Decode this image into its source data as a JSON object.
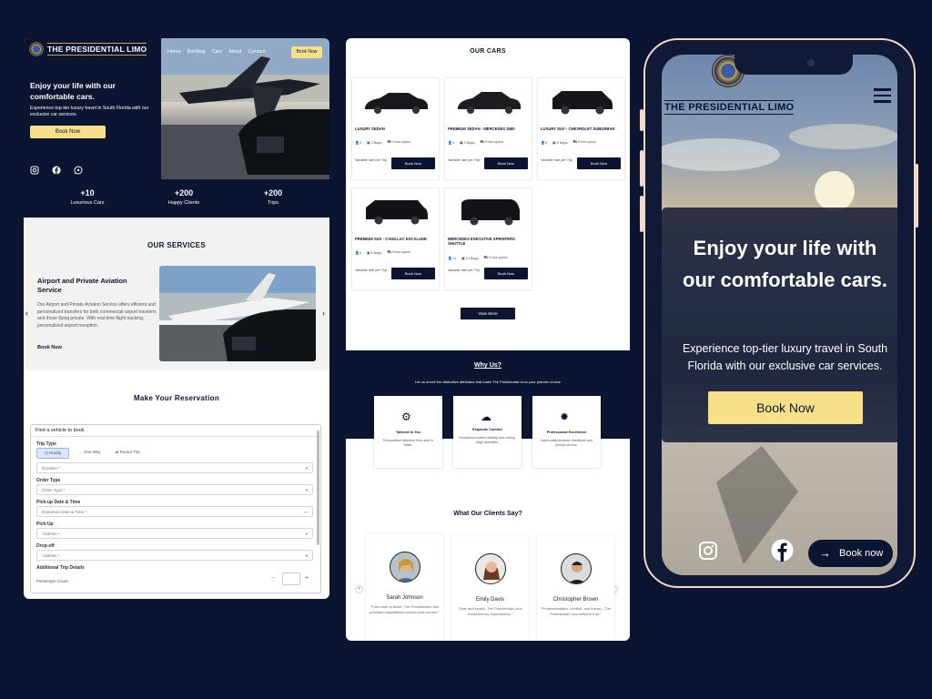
{
  "panel1": {
    "brand": "THE PRESIDENTIAL LIMO",
    "nav": [
      "Home",
      "Booking",
      "Cars",
      "About",
      "Contact"
    ],
    "nav_cta": "Book Now",
    "hero_title": "Enjoy your life with our comfortable cars.",
    "hero_sub": "Experience top-tier luxury travel in South Florida with our exclusive car services.",
    "hero_cta": "Book Now",
    "stats": [
      {
        "num": "+10",
        "label": "Luxurious Cars"
      },
      {
        "num": "+200",
        "label": "Happy Clients"
      },
      {
        "num": "+200",
        "label": "Trips"
      }
    ],
    "services_title": "OUR SERVICES",
    "service_name": "Airport and Private Aviation Service",
    "service_desc": "Our Airport and Private Aviation Service offers efficient and personalized transfers for both commercial airport travelers and those flying private. With real-time flight tracking, personalized airport reception.",
    "service_link": "Book Now",
    "reservation_title": "Make Your Reservation",
    "form": {
      "heading": "Find a vehicle to book",
      "trip_type_label": "Trip Type",
      "trip_types": [
        "Hourly",
        "One Way",
        "Round Trip"
      ],
      "duration_placeholder": "Duration *",
      "order_type_label": "Order Type",
      "order_type_placeholder": "Order Type *",
      "pickup_dt_label": "Pick-up Date & Time",
      "pickup_dt_placeholder": "Departure Date & Time *",
      "pickup_label": "Pick-Up",
      "pickup_placeholder": "Address *",
      "dropoff_label": "Drop-off",
      "dropoff_placeholder": "Address *",
      "additional_label": "Additional Trip Details",
      "passenger_label": "Passenger Count"
    }
  },
  "panel2": {
    "cars_title": "OUR CARS",
    "cars": [
      {
        "name": "LUXURY SEDAN",
        "pax": "3",
        "bags": "3 Bags",
        "space": "Extra space",
        "rate": "Variable rate per Trip",
        "cta": "Book Now"
      },
      {
        "name": "PREMIUM SEDAN - MERCEDES 2580",
        "pax": "3",
        "bags": "3 Bags",
        "space": "Extra space",
        "rate": "Variable rate per Trip",
        "cta": "Book Now"
      },
      {
        "name": "LUXURY SUV - CHEVROLET SUBURBAN",
        "pax": "6",
        "bags": "6 Bags",
        "space": "Extra space",
        "rate": "Variable rate per Trip",
        "cta": "Book Now"
      },
      {
        "name": "PREMIUM SUV - CADILLAC ESCALADE",
        "pax": "6",
        "bags": "6 Bags",
        "space": "Extra space",
        "rate": "Variable rate per Trip",
        "cta": "Book Now"
      },
      {
        "name": "MERCEDES EXECUTIVE SPRINTERS SHUTTLE",
        "pax": "14",
        "bags": "14 Bags",
        "space": "Extra space",
        "rate": "Variable rate per Trip",
        "cta": "Book Now"
      }
    ],
    "view_more": "View More",
    "why_title": "Why Us?",
    "why_sub": "Let us unveil the distinctive attributes that make The Presidential Limo your premier choice",
    "why_items": [
      {
        "title": "Tailored to You",
        "desc": "Personalized attention from start to finish."
      },
      {
        "title": "Exquisite Comfort",
        "desc": "Sumptuous leather seating and cutting-edge amenities."
      },
      {
        "title": "Professional Excellence",
        "desc": "Impeccably dressed chauffeurs and prompt service."
      }
    ],
    "clients_title": "What Our Clients Say?",
    "testimonials": [
      {
        "name": "Sarah Johnson",
        "quote": "\"From start to finish, The Presidential Limo provided unparalleled service and comfort.\""
      },
      {
        "name": "Emily Davis",
        "quote": "\"Safe and stylish, The Presidential Limo exceeded my expectations.\""
      },
      {
        "name": "Christopher Brown",
        "quote": "\"Professionalism, comfort, and luxury—The Presidential Limo delivers it all.\""
      }
    ]
  },
  "phone": {
    "brand": "THE PRESIDENTIAL LIMO",
    "hero_title": "Enjoy your life with our comfortable cars.",
    "hero_sub": "Experience top-tier luxury travel in South Florida with our exclusive car services.",
    "cta": "Book Now",
    "bottom_cta": "Book now"
  },
  "colors": {
    "navy": "#0b1430",
    "yellow": "#f6e08a",
    "gold": "#c9a64a",
    "bezel": "#f3d9c5"
  }
}
